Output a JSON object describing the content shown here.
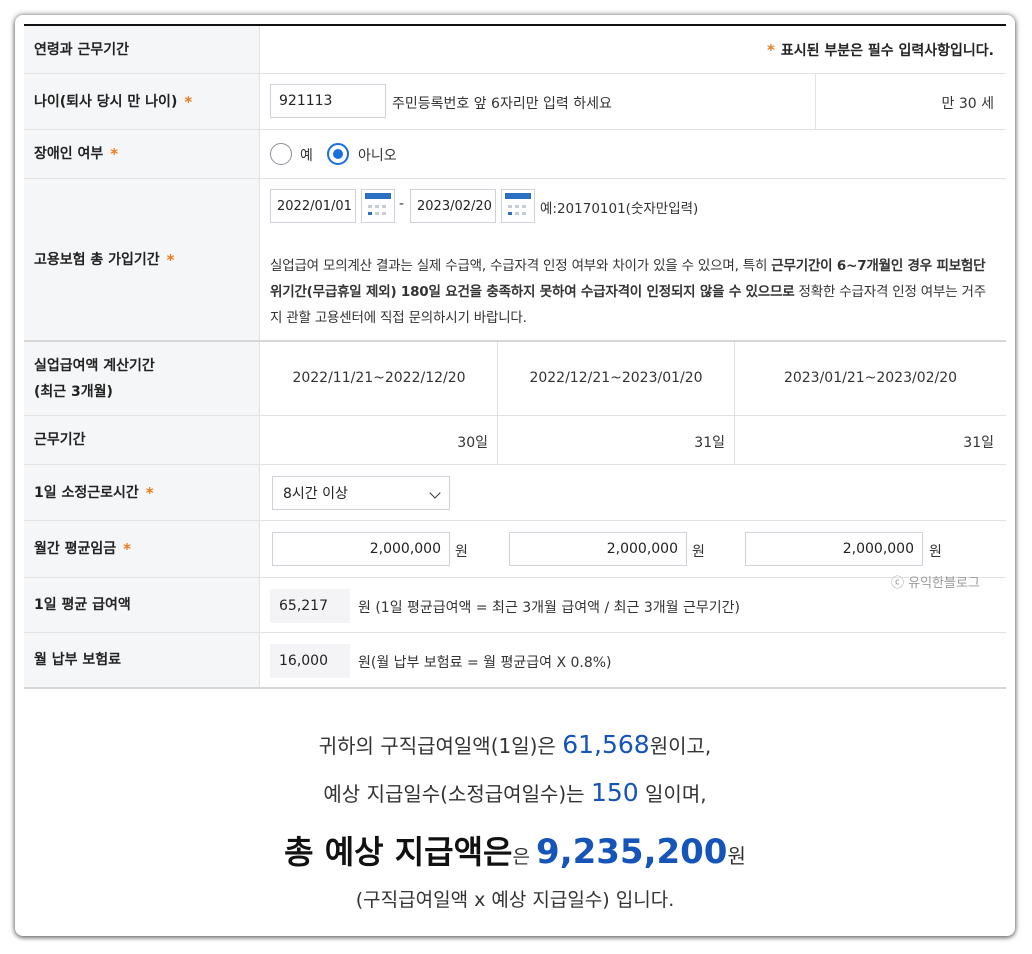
{
  "header": {
    "title": "연령과 근무기간",
    "required_star": "*",
    "required_note": "표시된 부분은 필수 입력사항입니다."
  },
  "age": {
    "label": "나이(퇴사 당시 만 나이)",
    "value": "921113",
    "hint": "주민등록번호 앞 6자리만 입력 하세요",
    "result": "만 30 세"
  },
  "disability": {
    "label": "장애인 여부",
    "options": [
      {
        "label": "예",
        "selected": false
      },
      {
        "label": "아니오",
        "selected": true
      }
    ]
  },
  "insurance_period": {
    "label": "고용보험 총 가입기간",
    "start_date": "2022/01/01",
    "separator": "-",
    "end_date": "2023/02/20",
    "date_hint": "예:20170101(숫자만입력)",
    "notice_normal_1": "실업급여 모의계산 결과는 실제 수급액, 수급자격 인정 여부와 차이가 있을 수 있으며, 특히 ",
    "notice_bold": "근무기간이 6~7개월인 경우 피보험단위기간(무급휴일 제외) 180일 요건을 충족하지 못하여 수급자격이 인정되지 않을 수 있으므로",
    "notice_normal_2": " 정확한 수급자격 인정 여부는 거주지 관할 고용센터에 직접 문의하시기 바랍니다."
  },
  "calc_period": {
    "label_line1": "실업급여액 계산기간",
    "label_line2": "(최근 3개월)",
    "periods": [
      "2022/11/21~2022/12/20",
      "2022/12/21~2023/01/20",
      "2023/01/21~2023/02/20"
    ]
  },
  "work_days": {
    "label": "근무기간",
    "values": [
      "30일",
      "31일",
      "31일"
    ]
  },
  "daily_hours": {
    "label": "1일 소정근로시간",
    "selected": "8시간 이상"
  },
  "monthly_wage": {
    "label": "월간 평균임금",
    "values": [
      "2,000,000",
      "2,000,000",
      "2,000,000"
    ],
    "unit": "원",
    "watermark": "ⓒ 유익한블로그"
  },
  "daily_benefit": {
    "label": "1일 평균 급여액",
    "value": "65,217",
    "note": "원 (1일 평균급여액 = 최근 3개월 급여액 / 최근 3개월 근무기간)"
  },
  "monthly_premium": {
    "label": "월 납부 보험료",
    "value": "16,000",
    "note": "원(월 납부 보험료 = 월 평균급여 X 0.8%)"
  },
  "result": {
    "line1_prefix": "귀하의 구직급여일액(1일)은 ",
    "line1_value": "61,568",
    "line1_suffix": "원이고,",
    "line2_prefix": "예상 지급일수(소정급여일수)는 ",
    "line2_value": "150",
    "line2_suffix": " 일이며,",
    "line3_big": "총 예상 지급액은",
    "line3_small": "은 ",
    "line3_value": "9,235,200",
    "line3_suffix": "원",
    "line4": "(구직급여일액 x 예상 지급일수) 입니다."
  },
  "colors": {
    "accent_star": "#f07a1a",
    "radio_blue": "#1a6ee0",
    "result_blue": "#1554b8",
    "label_bg": "#f5f6f8"
  }
}
